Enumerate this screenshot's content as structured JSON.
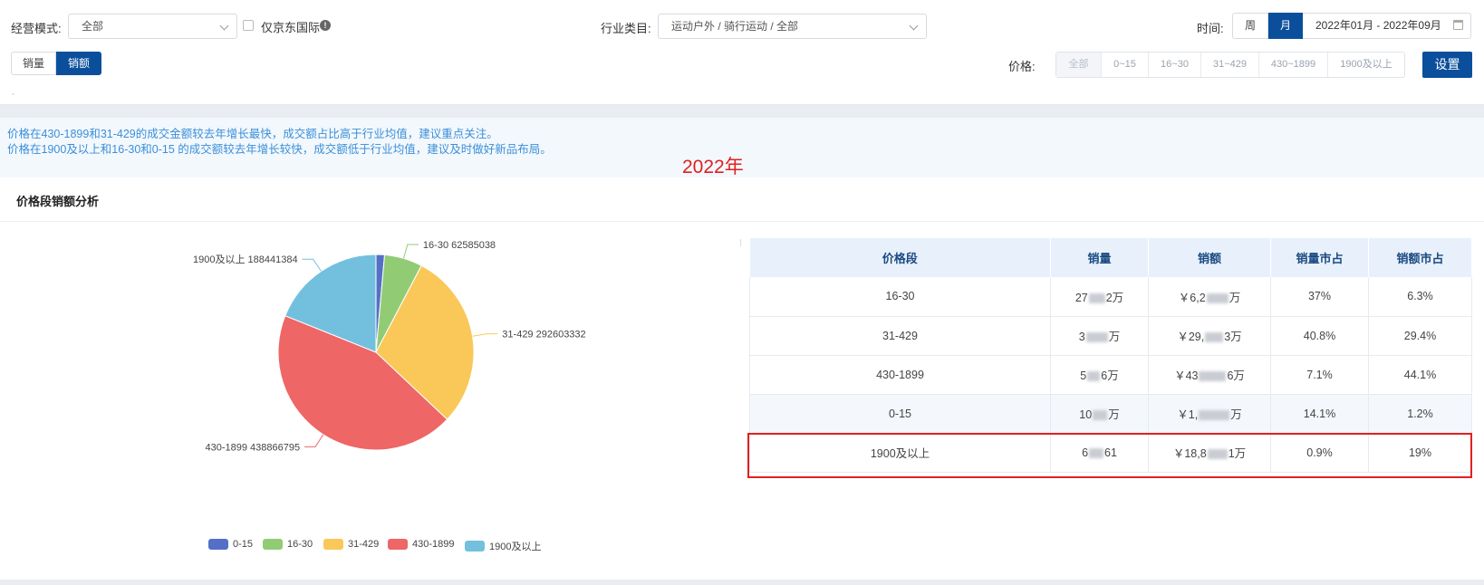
{
  "filters": {
    "mode_label": "经营模式:",
    "mode_value": "全部",
    "jd_intl_label": "仅京东国际",
    "industry_label": "行业类目:",
    "industry_value": "运动户外 / 骑行运动 / 全部",
    "time_label": "时间:",
    "time_week": "周",
    "time_month": "月",
    "date_range": "2022年01月 - 2022年09月",
    "metric_volume": "销量",
    "metric_amount": "销额",
    "price_label": "价格:",
    "price_options": [
      "全部",
      "0~15",
      "16~30",
      "31~429",
      "430~1899",
      "1900及以上"
    ],
    "settings_button": "设置"
  },
  "insight": {
    "line1": "价格在430-1899和31-429的成交金额较去年增长最快，成交额占比高于行业均值，建议重点关注。",
    "line2": "价格在1900及以上和16-30和0-15 的成交额较去年增长较快，成交额低于行业均值，建议及时做好新品布局。"
  },
  "annotation": {
    "year": "2022年"
  },
  "card": {
    "title": "价格段销额分析"
  },
  "chart_data": {
    "type": "pie",
    "title": "",
    "series": [
      {
        "name": "0-15",
        "value": 14000000,
        "color": "#5470c6",
        "label": ""
      },
      {
        "name": "16-30",
        "value": 62585038,
        "color": "#91cc75",
        "label": "16-30   62585038"
      },
      {
        "name": "31-429",
        "value": 292603332,
        "color": "#fac858",
        "label": "31-429   292603332"
      },
      {
        "name": "430-1899",
        "value": 438866795,
        "color": "#ee6666",
        "label": "430-1899   438866795"
      },
      {
        "name": "1900及以上",
        "value": 188441384,
        "color": "#73c0de",
        "label": "1900及以上   188441384"
      }
    ],
    "legend": [
      "0-15",
      "16-30",
      "31-429",
      "430-1899",
      "1900及以上"
    ],
    "legend_position": "bottom"
  },
  "table": {
    "headers": [
      "价格段",
      "销量",
      "销额",
      "销量市占",
      "销额市占"
    ],
    "rows": [
      {
        "segment": "16-30",
        "vol_a": "27",
        "vol_b": "2万",
        "amt_a": "￥6,2",
        "amt_b": "万",
        "vol_share": "37%",
        "amt_share": "6.3%"
      },
      {
        "segment": "31-429",
        "vol_a": "3",
        "vol_b": "万",
        "amt_a": "￥29,",
        "amt_b": "3万",
        "vol_share": "40.8%",
        "amt_share": "29.4%"
      },
      {
        "segment": "430-1899",
        "vol_a": "5",
        "vol_b": "6万",
        "amt_a": "￥43",
        "amt_b": "6万",
        "vol_share": "7.1%",
        "amt_share": "44.1%"
      },
      {
        "segment": "0-15",
        "vol_a": "10",
        "vol_b": "万",
        "amt_a": "￥1,",
        "amt_b": "万",
        "vol_share": "14.1%",
        "amt_share": "1.2%"
      },
      {
        "segment": "1900及以上",
        "vol_a": "6",
        "vol_b": "61",
        "amt_a": "￥18,8",
        "amt_b": "1万",
        "vol_share": "0.9%",
        "amt_share": "19%"
      }
    ]
  }
}
